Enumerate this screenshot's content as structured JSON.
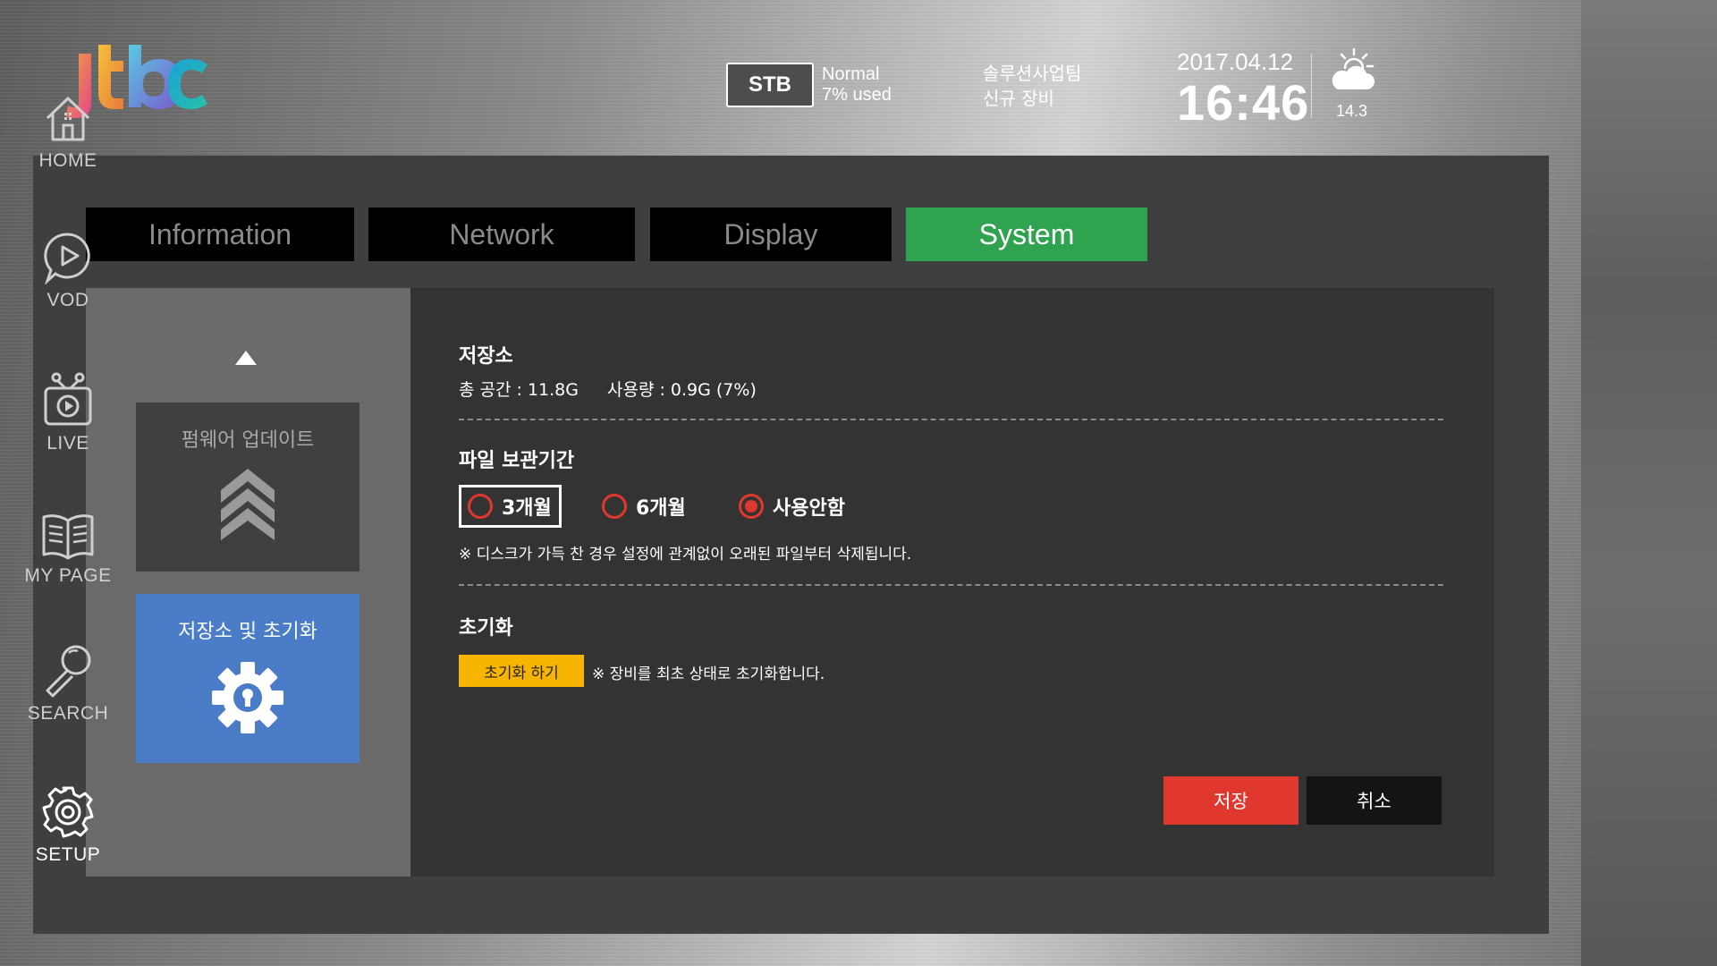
{
  "header": {
    "logo_text": "jtbc",
    "stb_label": "STB",
    "stb_status": "Normal",
    "stb_usage": "7% used",
    "device_team": "솔루션사업팀",
    "device_name": "신규 장비",
    "date": "2017.04.12",
    "time": "16:46",
    "weather_icon": "partly-cloudy-icon",
    "temperature": "14.3"
  },
  "tabs": [
    {
      "label": "Information",
      "active": false
    },
    {
      "label": "Network",
      "active": false
    },
    {
      "label": "Display",
      "active": false
    },
    {
      "label": "System",
      "active": true
    }
  ],
  "sidebar": {
    "items": [
      {
        "label": "펌웨어 업데이트",
        "icon": "upgrade-chevrons-icon",
        "selected": false
      },
      {
        "label": "저장소 및 초기화",
        "icon": "gear-lock-icon",
        "selected": true
      }
    ]
  },
  "storage": {
    "title": "저장소",
    "total": "총 공간 : 11.8G",
    "used": "사용량 : 0.9G (7%)"
  },
  "retention": {
    "title": "파일 보관기간",
    "options": [
      {
        "label": "3개월",
        "checked": false,
        "focused": true
      },
      {
        "label": "6개월",
        "checked": false,
        "focused": false
      },
      {
        "label": "사용안함",
        "checked": true,
        "focused": false
      }
    ],
    "note": "※ 디스크가 가득 찬 경우 설정에 관계없이 오래된 파일부터 삭제됩니다."
  },
  "reset": {
    "title": "초기화",
    "button_label": "초기화 하기",
    "note": "※ 장비를 최초 상태로 초기화합니다."
  },
  "actions": {
    "save_label": "저장",
    "cancel_label": "취소"
  },
  "nav": {
    "items": [
      {
        "label": "HOME",
        "icon": "home-icon",
        "active": false
      },
      {
        "label": "VOD",
        "icon": "vod-play-icon",
        "active": false
      },
      {
        "label": "LIVE",
        "icon": "live-tv-icon",
        "active": false
      },
      {
        "label": "MY PAGE",
        "icon": "book-icon",
        "active": false
      },
      {
        "label": "SEARCH",
        "icon": "search-icon",
        "active": false
      },
      {
        "label": "SETUP",
        "icon": "gear-icon",
        "active": true
      }
    ]
  },
  "colors": {
    "active_tab": "#2fa34f",
    "selected_menu": "#4a7cc8",
    "radio": "#e0382f",
    "reset_button": "#f7b400",
    "save_button": "#e0382f"
  }
}
